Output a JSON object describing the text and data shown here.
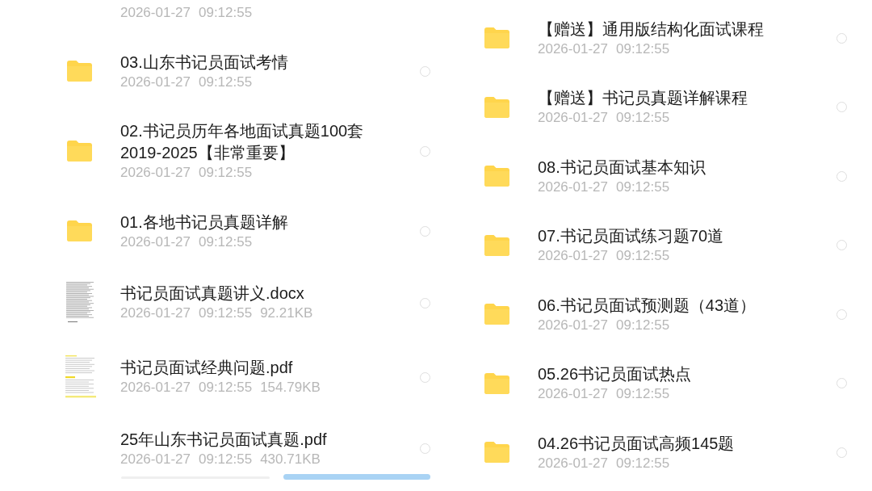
{
  "panels": [
    {
      "items": [
        {
          "date": "2026-01-27",
          "time": "09:12:55"
        },
        {
          "kind": "folder",
          "name": "03.山东书记员面试考情",
          "date": "2026-01-27",
          "time": "09:12:55",
          "selected": false
        },
        {
          "kind": "folder",
          "name": "02.书记员历年各地面试真题100套2019-2025【非常重要】",
          "date": "2026-01-27",
          "time": "09:12:55",
          "selected": false
        },
        {
          "kind": "folder",
          "name": "01.各地书记员真题详解",
          "date": "2026-01-27",
          "time": "09:12:55",
          "selected": false
        },
        {
          "kind": "doc",
          "name": "书记员面试真题讲义.docx",
          "date": "2026-01-27",
          "time": "09:12:55",
          "size": "92.21KB",
          "selected": false
        },
        {
          "kind": "pdf",
          "name": "书记员面试经典问题.pdf",
          "date": "2026-01-27",
          "time": "09:12:55",
          "size": "154.79KB",
          "selected": false
        },
        {
          "kind": "file",
          "name": "25年山东书记员面试真题.pdf",
          "date": "2026-01-27",
          "time": "09:12:55",
          "size": "430.71KB",
          "selected": false
        }
      ],
      "bottom_bar": {
        "buttons": [
          {
            "kind": "secondary"
          },
          {
            "kind": "primary"
          }
        ]
      }
    },
    {
      "items": [
        {
          "kind": "folder",
          "name": "【赠送】通用版结构化面试课程",
          "date": "2026-01-27",
          "time": "09:12:55",
          "selected": false
        },
        {
          "kind": "folder",
          "name": "【赠送】书记员真题详解课程",
          "date": "2026-01-27",
          "time": "09:12:55",
          "selected": false
        },
        {
          "kind": "folder",
          "name": "08.书记员面试基本知识",
          "date": "2026-01-27",
          "time": "09:12:55",
          "selected": false
        },
        {
          "kind": "folder",
          "name": "07.书记员面试练习题70道",
          "date": "2026-01-27",
          "time": "09:12:55",
          "selected": false
        },
        {
          "kind": "folder",
          "name": "06.书记员面试预测题（43道）",
          "date": "2026-01-27",
          "time": "09:12:55",
          "selected": false
        },
        {
          "kind": "folder",
          "name": "05.26书记员面试热点",
          "date": "2026-01-27",
          "time": "09:12:55",
          "selected": false
        },
        {
          "kind": "folder",
          "name": "04.26书记员面试高频145题",
          "date": "2026-01-27",
          "time": "09:12:55",
          "selected": false
        }
      ]
    }
  ]
}
